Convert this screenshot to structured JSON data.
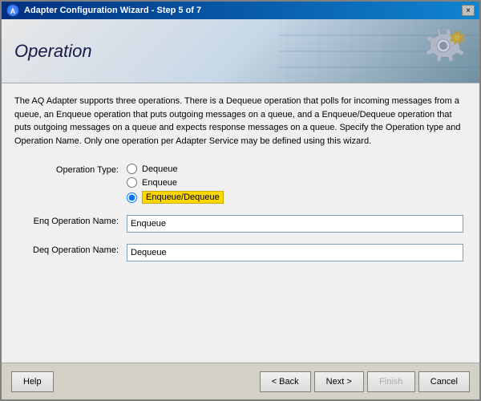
{
  "window": {
    "title": "Adapter Configuration Wizard - Step 5 of 7",
    "close_label": "×"
  },
  "header": {
    "title": "Operation"
  },
  "description": "The AQ Adapter supports three operations.  There is a Dequeue operation that polls for incoming messages from a queue, an Enqueue operation that puts outgoing messages on a queue, and a Enqueue/Dequeue operation that puts outgoing messages on a queue and expects response messages on a queue.  Specify the Operation type and Operation Name. Only one operation per Adapter Service may be defined using this wizard.",
  "form": {
    "operation_type_label": "Operation Type:",
    "radio_options": [
      {
        "id": "dequeue",
        "label": "Dequeue",
        "selected": false
      },
      {
        "id": "enqueue",
        "label": "Enqueue",
        "selected": false
      },
      {
        "id": "enqueue_dequeue",
        "label": "Enqueue/Dequeue",
        "selected": true
      }
    ],
    "enq_label": "Enq Operation Name:",
    "enq_value": "Enqueue",
    "deq_label": "Deq Operation Name:",
    "deq_value": "Dequeue"
  },
  "footer": {
    "help_label": "Help",
    "back_label": "< Back",
    "next_label": "Next >",
    "finish_label": "Finish",
    "cancel_label": "Cancel"
  }
}
